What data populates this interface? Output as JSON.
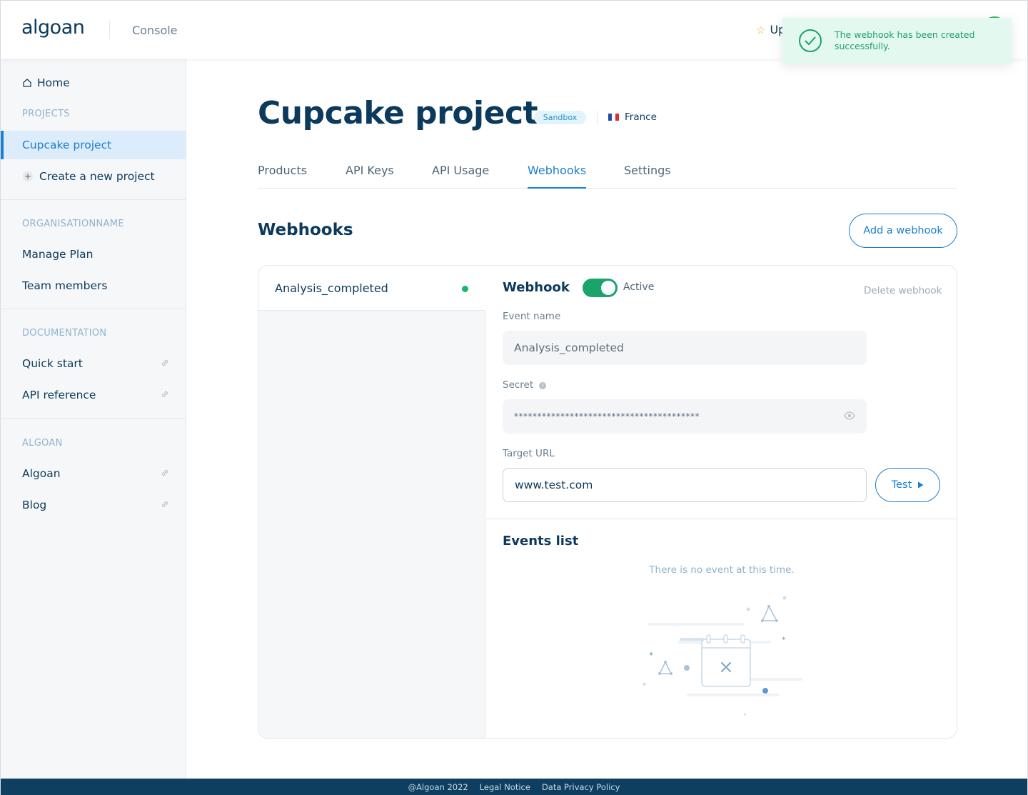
{
  "header": {
    "logo": "algoan",
    "app_name": "Console",
    "upgrade_label": "Up"
  },
  "toast": {
    "message": "The webhook has been created successfully.",
    "color": "#1da06e"
  },
  "sidebar": {
    "home": "Home",
    "projects_heading": "PROJECTS",
    "active_project": "Cupcake project",
    "create_project": "Create a new project",
    "org_heading": "ORGANISATIONNAME",
    "manage_plan": "Manage Plan",
    "team_members": "Team members",
    "docs_heading": "DOCUMENTATION",
    "quick_start": "Quick start",
    "api_reference": "API reference",
    "algoan_heading": "ALGOAN",
    "algoan_link": "Algoan",
    "blog": "Blog"
  },
  "project": {
    "title": "Cupcake project",
    "environment_badge": "Sandbox",
    "country": "France"
  },
  "tabs": [
    "Products",
    "API Keys",
    "API Usage",
    "Webhooks",
    "Settings"
  ],
  "active_tab": "Webhooks",
  "webhooks": {
    "section_title": "Webhooks",
    "add_button": "Add a webhook",
    "list": [
      {
        "name": "Analysis_completed",
        "status": "active"
      }
    ],
    "detail": {
      "title": "Webhook",
      "toggle_label": "Active",
      "toggle_on": true,
      "delete_label": "Delete webhook",
      "event_name_label": "Event name",
      "event_name_value": "Analysis_completed",
      "secret_label": "Secret",
      "secret_value": "****************************************",
      "target_url_label": "Target URL",
      "target_url_value": "www.test.com",
      "test_button": "Test"
    },
    "events": {
      "title": "Events list",
      "empty_message": "There is no event at this time."
    }
  },
  "footer": {
    "copyright": "@Algoan 2022",
    "legal": "Legal Notice",
    "privacy": "Data Privacy Policy"
  },
  "colors": {
    "primary": "#1a7fd0",
    "navy": "#0b3a5c",
    "success": "#1aa36b",
    "footer_bg": "#0f3f60"
  }
}
